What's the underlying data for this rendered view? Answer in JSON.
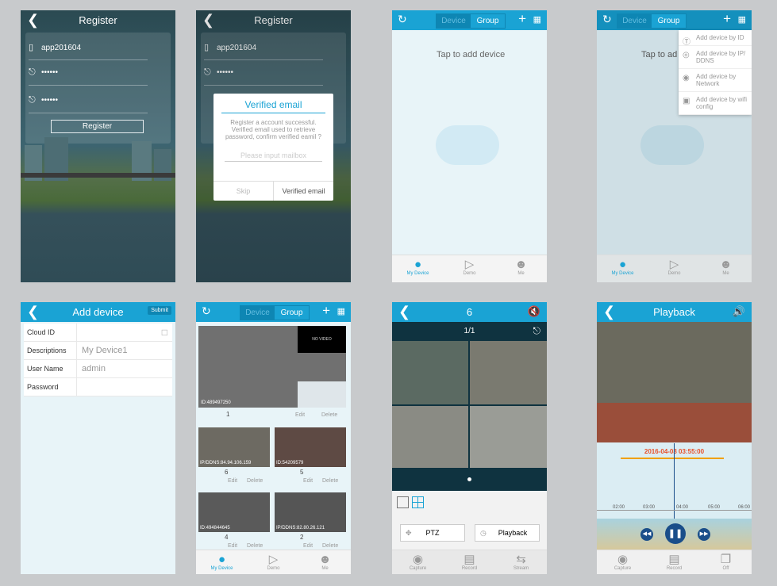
{
  "register": {
    "title": "Register",
    "username": "app201604",
    "password_mask": "••••••",
    "confirm_mask": "••••••",
    "button": "Register"
  },
  "verify": {
    "title": "Register",
    "username": "app201604",
    "password_mask": "••••••",
    "dialog_title": "Verified email",
    "dialog_message": "Register a account successful. Verified email used to retrieve password, confirm verified eamil ?",
    "email_placeholder": "Please input mailbox",
    "skip": "Skip",
    "confirm": "Verified email"
  },
  "empty": {
    "seg_device": "Device",
    "seg_group": "Group",
    "tap_hint": "Tap to add device",
    "tabs": [
      "My Device",
      "Demo",
      "Me"
    ]
  },
  "addmenu": {
    "seg_device": "Device",
    "seg_group": "Group",
    "tap_hint": "Tap to ad",
    "items": [
      "Add device by ID",
      "Add device by IP/ DDNS",
      "Add device by Network",
      "Add device by wifi config"
    ],
    "tabs": [
      "My Device",
      "Demo",
      "Me"
    ]
  },
  "adddevice": {
    "title": "Add device",
    "submit": "Submit",
    "rows": [
      {
        "label": "Cloud ID",
        "value": ""
      },
      {
        "label": "Descriptions",
        "value": "My Device1"
      },
      {
        "label": "User Name",
        "value": "admin"
      },
      {
        "label": "Password",
        "value": ""
      }
    ]
  },
  "grid": {
    "seg_device": "Device",
    "seg_group": "Group",
    "no_video": "NO VIDEO",
    "cards": [
      {
        "id": "ID:489497250",
        "num": "1"
      },
      {
        "id": "IP/DDNS:84.94.106.159",
        "num": "6"
      },
      {
        "id": "ID:54209579",
        "num": "5"
      },
      {
        "id": "ID:494844645",
        "num": "4"
      },
      {
        "id": "IP/DDNS:82.80.26.121",
        "num": "2"
      }
    ],
    "edit": "Edit",
    "delete": "Delete",
    "tabs": [
      "My Device",
      "Demo",
      "Me"
    ]
  },
  "live": {
    "title": "6",
    "page": "1/1",
    "ptz": "PTZ",
    "playback": "Playback",
    "tabs": [
      "Capture",
      "Record",
      "Stream"
    ]
  },
  "playback": {
    "title": "Playback",
    "datetime": "2016-04-08 03:55:00",
    "ticks": [
      "02:00",
      "03:00",
      "04:00",
      "05:00",
      "06:00"
    ],
    "tabs": [
      "Capture",
      "Record",
      "Off"
    ]
  }
}
